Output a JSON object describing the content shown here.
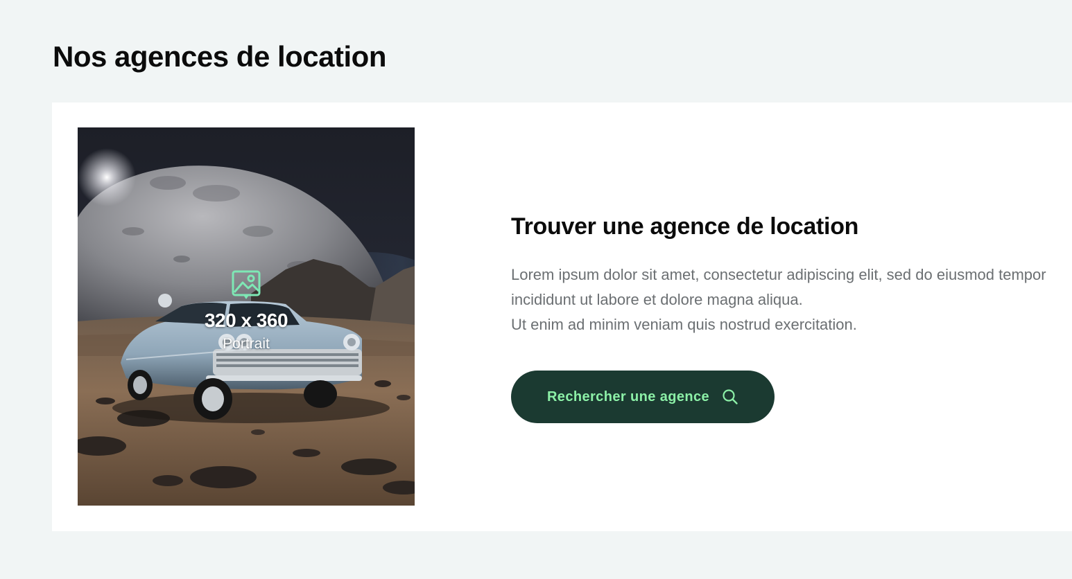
{
  "section": {
    "title": "Nos agences de location"
  },
  "card": {
    "image": {
      "size_label": "320 x 360",
      "orientation_label": "Portrait",
      "icon": "image-icon"
    },
    "title": "Trouver une agence de location",
    "description_lines": [
      "Lorem ipsum dolor sit amet, consectetur adipiscing elit, sed do eiusmod tempor",
      "incididunt ut labore et dolore magna aliqua.",
      "Ut enim ad minim veniam quis nostrud exercitation."
    ],
    "button": {
      "label": "Rechercher une agence",
      "icon": "search-icon"
    }
  },
  "colors": {
    "page_background": "#f1f5f5",
    "card_background": "#ffffff",
    "button_background": "#1b3a31",
    "button_text": "#8cf0a7",
    "icon_accent": "#7ee8b5",
    "body_text": "#6b6f72",
    "heading_text": "#0b0b0b"
  }
}
